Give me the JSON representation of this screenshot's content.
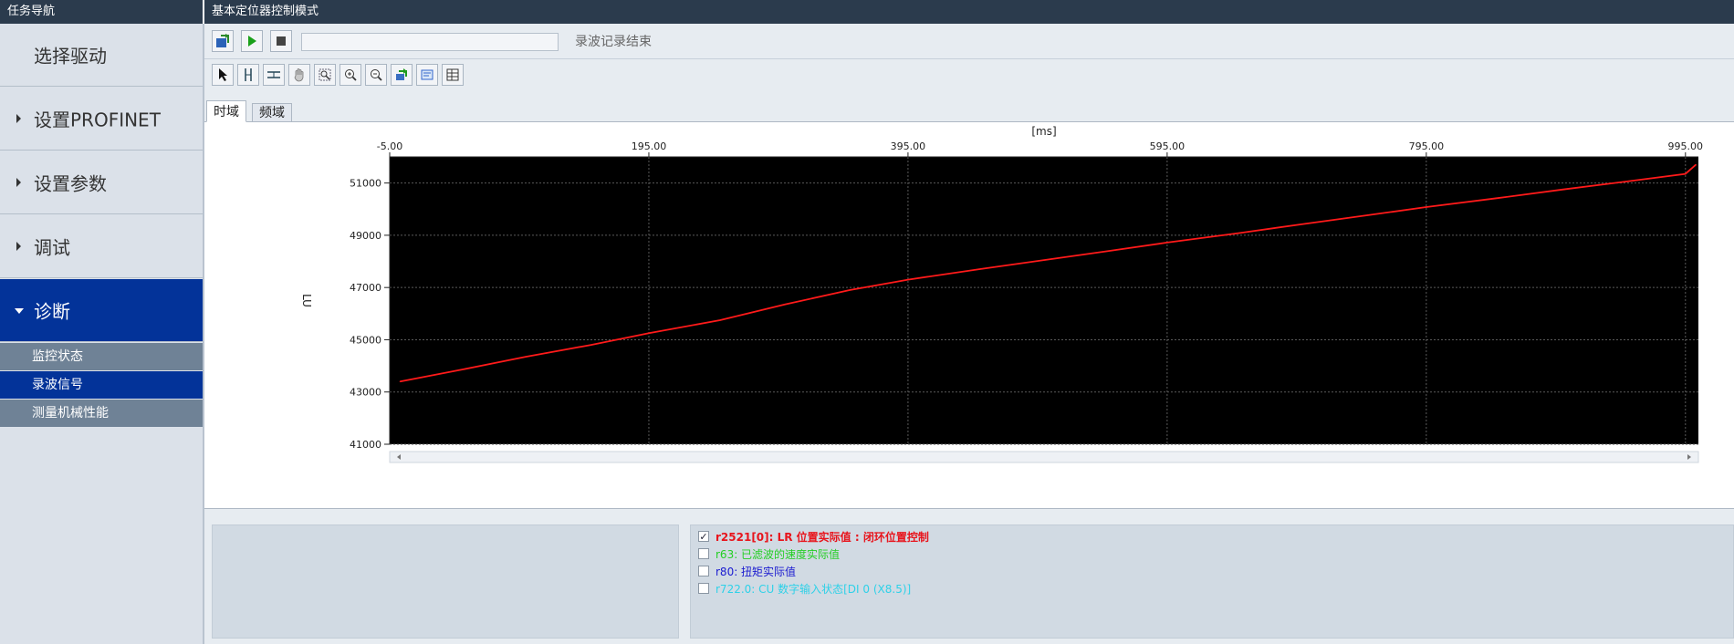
{
  "window": {
    "left_title": "任务导航",
    "right_title": "基本定位器控制模式"
  },
  "sidebar": {
    "items": [
      {
        "label": "选择驱动"
      },
      {
        "label": "设置PROFINET"
      },
      {
        "label": "设置参数"
      },
      {
        "label": "调试"
      },
      {
        "label": "诊断"
      }
    ],
    "subitems": [
      {
        "label": "监控状态"
      },
      {
        "label": "录波信号"
      },
      {
        "label": "测量机械性能"
      }
    ]
  },
  "toolbar": {
    "status": "录波记录结束",
    "icons": [
      "pointer-icon",
      "vertical-cursor-icon",
      "horizontal-cursor-icon",
      "hand-pan-icon",
      "zoom-fit-icon",
      "zoom-in-icon",
      "zoom-out-icon",
      "export-icon",
      "settings-icon",
      "table-icon"
    ]
  },
  "tabs": {
    "time": "时域",
    "freq": "频域"
  },
  "colors": {
    "selected": "#033399",
    "plot_bg": "#000000",
    "trace": "#ff1a1a"
  },
  "chart_data": {
    "type": "line",
    "xlabel": "[ms]",
    "ylabel": "LU",
    "xlim": [
      -5,
      1005
    ],
    "ylim": [
      41000,
      52000
    ],
    "x_ticks": [
      "-5.00",
      "195.00",
      "395.00",
      "595.00",
      "795.00",
      "995.00"
    ],
    "y_ticks": [
      "41000",
      "43000",
      "45000",
      "47000",
      "49000",
      "51000"
    ],
    "grid": true,
    "series": [
      {
        "name": "r2521[0]: LR 位置实际值 : 闭环位置控制",
        "x": [
          3,
          50,
          100,
          150,
          195,
          250,
          300,
          350,
          395,
          450,
          500,
          550,
          595,
          650,
          700,
          750,
          795,
          850,
          900,
          950,
          995,
          1003
        ],
        "y": [
          43400,
          43850,
          44350,
          44800,
          45250,
          45750,
          46350,
          46900,
          47300,
          47700,
          48050,
          48400,
          48720,
          49080,
          49430,
          49770,
          50080,
          50420,
          50750,
          51060,
          51350,
          51700
        ]
      }
    ]
  },
  "legend": [
    {
      "label": "r2521[0]: LR 位置实际值 : 闭环位置控制",
      "checked": true,
      "color": "#e8141c"
    },
    {
      "label": "r63: 已滤波的速度实际值",
      "checked": false,
      "color": "#24cf24"
    },
    {
      "label": "r80: 扭矩实际值",
      "checked": false,
      "color": "#1a1ad0"
    },
    {
      "label": "r722.0: CU 数字输入状态[DI 0 (X8.5)]",
      "checked": false,
      "color": "#2ed1e8"
    }
  ]
}
